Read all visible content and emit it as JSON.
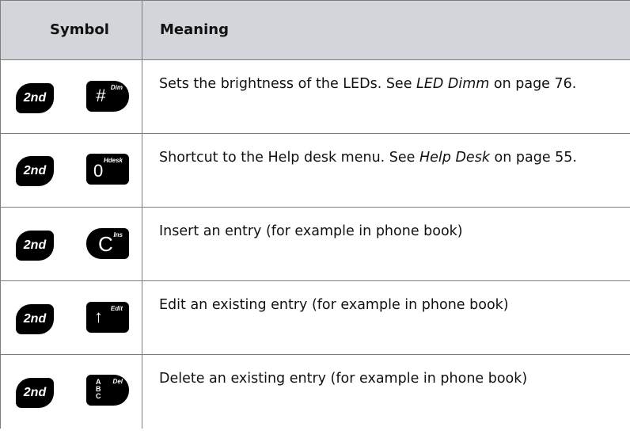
{
  "header": {
    "symbol": "Symbol",
    "meaning": "Meaning"
  },
  "rows": [
    {
      "key1_label": "2nd",
      "key2_main": "#",
      "key2_sub": "Dim",
      "key2_icon": "hash-key-icon",
      "desc_pre": "Sets the brightness of the LEDs. See ",
      "desc_ref": "LED Dimm",
      "desc_post": " on page 76."
    },
    {
      "key1_label": "2nd",
      "key2_main": "0",
      "key2_sub": "Hdesk",
      "key2_icon": "zero-key-icon",
      "desc_pre": "Shortcut to the Help desk menu. See ",
      "desc_ref": "Help Desk",
      "desc_post": " on page 55."
    },
    {
      "key1_label": "2nd",
      "key2_main": "C",
      "key2_sub": "Ins",
      "key2_icon": "c-key-icon",
      "desc_pre": "Insert an entry (for example in phone book)"
    },
    {
      "key1_label": "2nd",
      "key2_main": "↑",
      "key2_sub": "Edit",
      "key2_icon": "up-arrow-key-icon",
      "desc_pre": "Edit an existing entry (for example in phone book)"
    },
    {
      "key1_label": "2nd",
      "key2_main_lines": [
        "A",
        "B",
        "C"
      ],
      "key2_sub": "Del",
      "key2_icon": "abc-key-icon",
      "desc_pre": "Delete an existing entry (for example in phone book)"
    }
  ]
}
